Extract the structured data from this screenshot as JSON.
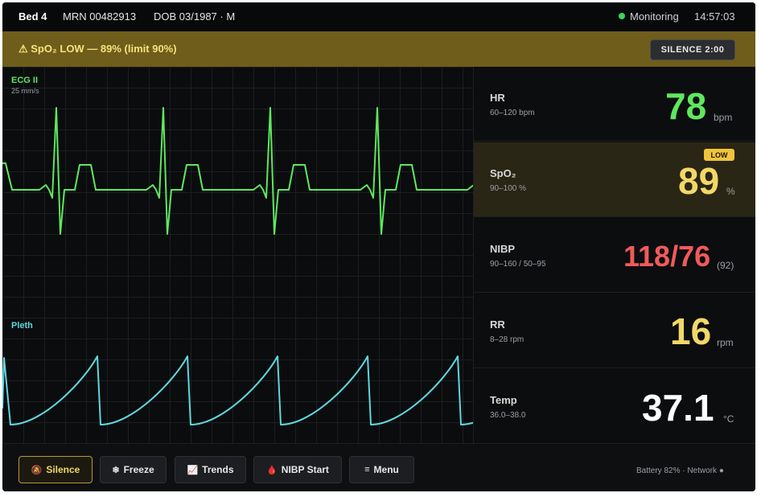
{
  "header": {
    "bed": "Bed 4",
    "mrn": "MRN 00482913",
    "dob": "DOB 03/1987 · M",
    "status": "Monitoring",
    "time": "14:57:03"
  },
  "alarm": {
    "text": "⚠ SpO₂ LOW — 89% (limit 90%)",
    "silence_label": "SILENCE 2:00"
  },
  "waveforms": {
    "ecg": {
      "label": "ECG II",
      "speed": "25 mm/s",
      "color": "#5ee85e"
    },
    "pleth": {
      "label": "Pleth",
      "color": "#5fd7df"
    }
  },
  "vitals": [
    {
      "name": "HR",
      "range": "60–120 bpm",
      "value": "78",
      "unit": "bpm",
      "color": "#5ee85e"
    },
    {
      "name": "SpO₂",
      "range": "90–100 %",
      "value": "89",
      "unit": "%",
      "color": "#f3d867",
      "badge": "LOW"
    },
    {
      "name": "NIBP",
      "range": "90–160 / 50–95",
      "value": "118/76",
      "unit": "(92)",
      "color": "#f05a5a"
    },
    {
      "name": "RR",
      "range": "8–28 rpm",
      "value": "16",
      "unit": "rpm",
      "color": "#f3d867"
    },
    {
      "name": "Temp",
      "range": "36.0–38.0",
      "value": "37.1",
      "unit": "°C",
      "color": "#ffffff"
    }
  ],
  "footer": {
    "buttons": [
      {
        "label": "Silence",
        "icon": "🔕"
      },
      {
        "label": "Freeze",
        "icon": "❄"
      },
      {
        "label": "Trends",
        "icon": "📈"
      },
      {
        "label": "NIBP Start",
        "icon": "🩸"
      },
      {
        "label": "Menu",
        "icon": "≡"
      }
    ],
    "status": "Battery 82% · Network ●"
  }
}
